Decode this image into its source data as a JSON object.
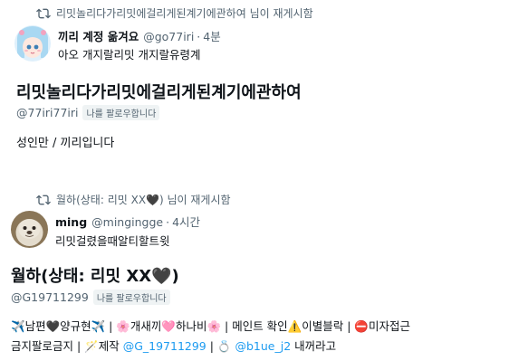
{
  "retweet1": {
    "icon": "retweet-icon",
    "text": "리밋놀리다가리밋에걸리게된계기에관하여 님이 재게시함"
  },
  "tweet1": {
    "avatar": "avatar-anime-girl",
    "name": "끼리 계정 옮겨요",
    "handle": "@go77iri",
    "dot": "·",
    "time": "4분",
    "text": "아오 개지랄리밋 개지랄유령계"
  },
  "profile1": {
    "name": "리밋놀리다가리밋에걸리게된계기에관하여",
    "handle": "@77iri77iri",
    "follows_badge": "나를 팔로우합니다",
    "bio": "성인만 / 끼리입니다"
  },
  "retweet2": {
    "icon": "retweet-icon",
    "text": "월하(상태: 리밋 XX🖤) 님이 재게시함"
  },
  "tweet2": {
    "avatar": "avatar-seal",
    "name": "ming",
    "handle": "@mingingge",
    "dot": "·",
    "time": "4시간",
    "text": "리밋걸렸을때알티할트윗"
  },
  "profile2": {
    "name": "월하(상태: 리밋 XX🖤)",
    "handle": "@G19711299",
    "follows_badge": "나를 팔로우합니다",
    "bio_line1_a": "✈️남편🖤양규현✈️ | 🌸개새끼🩷하나비🌸 | 메인트 확인⚠️이별블락 | ⛔미자접근",
    "bio_line2_a": "금지팔로금지 | 🪄제작 ",
    "bio_line2_link1": "@G_19711299",
    "bio_line2_b": " | 💍 ",
    "bio_line2_link2": "@b1ue_j2",
    "bio_line2_c": " 내꺼라고"
  },
  "colors": {
    "text": "#0f1419",
    "secondary": "#536471",
    "link": "#1d9bf0",
    "badge_bg": "#eff3f4"
  }
}
